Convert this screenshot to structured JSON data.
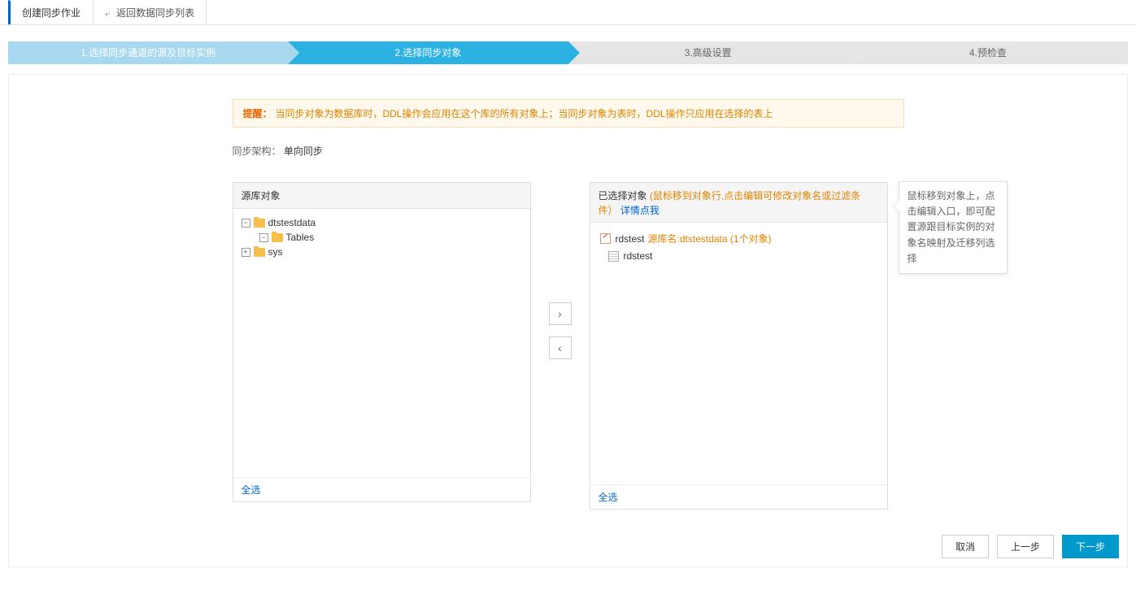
{
  "topbar": {
    "current_tab": "创建同步作业",
    "back_label": "返回数据同步列表"
  },
  "steps": [
    {
      "label": "1.选择同步通道的源及目标实例",
      "state": "completed"
    },
    {
      "label": "2.选择同步对象",
      "state": "active"
    },
    {
      "label": "3.高级设置",
      "state": "pending"
    },
    {
      "label": "4.预检查",
      "state": "pending"
    }
  ],
  "alert": {
    "label": "提醒：",
    "text": "当同步对象为数据库时，DDL操作会应用在这个库的所有对象上；当同步对象为表时，DDL操作只应用在选择的表上"
  },
  "architecture": {
    "label": "同步架构：",
    "value": "单向同步"
  },
  "source_panel": {
    "title": "源库对象",
    "tree": {
      "db_name": "dtstestdata",
      "tables_label": "Tables",
      "sys_label": "sys"
    },
    "select_all": "全选"
  },
  "selected_panel": {
    "title": "已选择对象",
    "hint": "(鼠标移到对象行,点击编辑可修改对象名或过滤条件）",
    "details_link": "详情点我",
    "items": [
      {
        "name": "rdstest",
        "source_prefix": "源库名:",
        "source_db": "dtstestdata",
        "count_suffix": " (1个对象)",
        "type": "db"
      },
      {
        "name": "rdstest",
        "type": "table"
      }
    ],
    "select_all": "全选"
  },
  "tooltip": "鼠标移到对象上，点击编辑入口，即可配置源跟目标实例的对象名映射及迁移列选择",
  "footer": {
    "cancel": "取消",
    "prev": "上一步",
    "next": "下一步"
  }
}
